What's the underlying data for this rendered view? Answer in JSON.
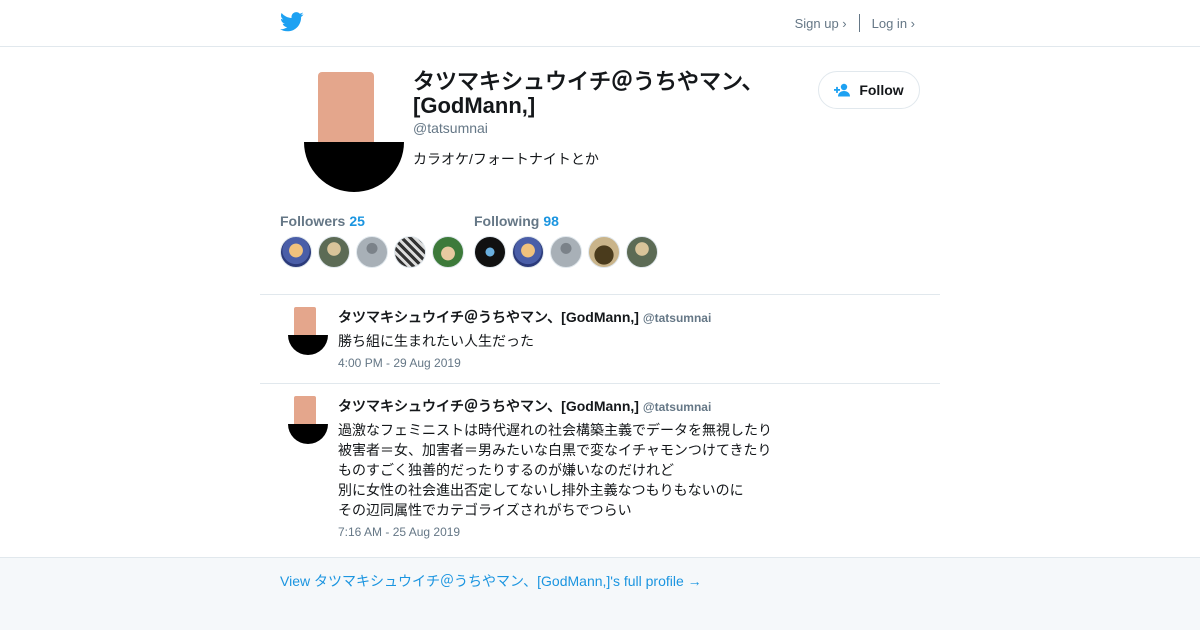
{
  "header": {
    "logo_icon": "twitter-bird-icon",
    "signup_label": "Sign up ›",
    "login_label": "Log in ›"
  },
  "profile": {
    "name": "タツマキシュウイチ＠うちやマン、[GodMann,]",
    "handle": "@tatsumnai",
    "bio": "カラオケ/フォートナイトとか",
    "follow_label": "Follow",
    "follow_icon": "add-user-icon"
  },
  "stats": {
    "followers_label": "Followers",
    "followers_count": "25",
    "following_label": "Following",
    "following_count": "98"
  },
  "tweets": [
    {
      "name": "タツマキシュウイチ＠うちやマン、[GodMann,]",
      "handle": "@tatsumnai",
      "lines": [
        "勝ち組に生まれたい人生だった"
      ],
      "time": "4:00 PM - 29 Aug 2019"
    },
    {
      "name": "タツマキシュウイチ＠うちやマン、[GodMann,]",
      "handle": "@tatsumnai",
      "lines": [
        "過激なフェミニストは時代遅れの社会構築主義でデータを無視したり",
        "被害者＝女、加害者＝男みたいな白黒で変なイチャモンつけてきたり",
        "ものすごく独善的だったりするのが嫌いなのだけれど",
        "別に女性の社会進出否定してないし排外主義なつもりもないのに",
        "その辺同属性でカテゴライズされがちでつらい"
      ],
      "time": "7:16 AM - 25 Aug 2019"
    }
  ],
  "footer": {
    "link_label": "View タツマキシュウイチ＠うちやマン、[GodMann,]'s full profile →"
  },
  "colors": {
    "brand": "#1da1f2",
    "link": "#1b95e0",
    "muted": "#657786",
    "avatar_skin": "#e4a68c"
  }
}
